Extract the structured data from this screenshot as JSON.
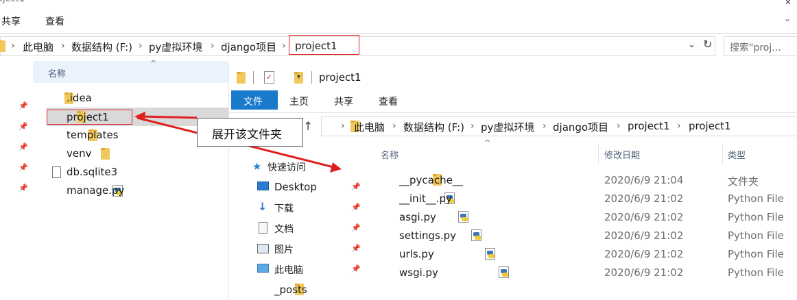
{
  "window_title_partial": "oject1",
  "ribbon_back": {
    "share": "共享",
    "view": "查看"
  },
  "address_back": {
    "crumbs": [
      "此电脑",
      "数据结构 (F:)",
      "py虚拟环境",
      "django项目",
      "project1"
    ],
    "search_placeholder": "搜索\"proj..."
  },
  "left_pane": {
    "header": "名称",
    "items": [
      {
        "name": ".idea",
        "icon": "folder-icon"
      },
      {
        "name": "project1",
        "icon": "folder-icon"
      },
      {
        "name": "templates",
        "icon": "folder-icon"
      },
      {
        "name": "venv",
        "icon": "folder-icon"
      },
      {
        "name": "db.sqlite3",
        "icon": "file-icon"
      },
      {
        "name": "manage.py",
        "icon": "python-file-icon"
      }
    ]
  },
  "annotation": {
    "text": "展开该文件夹",
    "color": "#e02020"
  },
  "front_window": {
    "title": "project1",
    "tabs": {
      "file": "文件",
      "home": "主页",
      "share": "共享",
      "view": "查看"
    },
    "crumbs": [
      "此电脑",
      "数据结构 (F:)",
      "py虚拟环境",
      "django项目",
      "project1",
      "project1"
    ],
    "nav": [
      {
        "label": "快速访问",
        "icon": "star-icon"
      },
      {
        "label": "Desktop",
        "icon": "desktop-icon"
      },
      {
        "label": "下载",
        "icon": "download-icon"
      },
      {
        "label": "文档",
        "icon": "document-icon"
      },
      {
        "label": "图片",
        "icon": "picture-icon"
      },
      {
        "label": "此电脑",
        "icon": "computer-icon"
      },
      {
        "label": "_posts",
        "icon": "folder-icon"
      }
    ],
    "columns": {
      "name": "名称",
      "modified": "修改日期",
      "type": "类型"
    },
    "files": [
      {
        "name": "__pycache__",
        "modified": "2020/6/9 21:04",
        "type": "文件夹",
        "icon": "folder-icon"
      },
      {
        "name": "__init__.py",
        "modified": "2020/6/9 21:02",
        "type": "Python File",
        "icon": "python-file-icon"
      },
      {
        "name": "asgi.py",
        "modified": "2020/6/9 21:02",
        "type": "Python File",
        "icon": "python-file-icon"
      },
      {
        "name": "settings.py",
        "modified": "2020/6/9 21:02",
        "type": "Python File",
        "icon": "python-file-icon"
      },
      {
        "name": "urls.py",
        "modified": "2020/6/9 21:02",
        "type": "Python File",
        "icon": "python-file-icon"
      },
      {
        "name": "wsgi.py",
        "modified": "2020/6/9 21:02",
        "type": "Python File",
        "icon": "python-file-icon"
      }
    ]
  },
  "colors": {
    "accent": "#1979ca",
    "selection": "#d9d9d9",
    "highlight_box": "#e02020"
  }
}
